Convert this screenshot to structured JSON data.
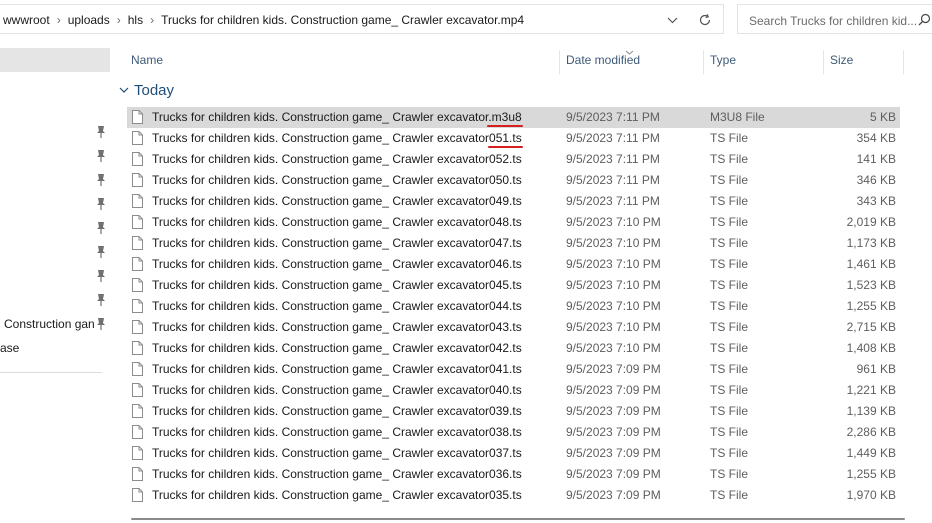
{
  "address": {
    "crumbs": [
      "wwwroot",
      "uploads",
      "hls",
      "Trucks for children kids. Construction game_ Crawler excavator.mp4"
    ]
  },
  "search": {
    "placeholder": "Search Trucks for children kid..."
  },
  "nav": {
    "items": [
      {
        "label": "Construction gan"
      },
      {
        "label": "ase"
      }
    ]
  },
  "columns": {
    "name": "Name",
    "date": "Date modified",
    "type": "Type",
    "size": "Size"
  },
  "group": {
    "label": "Today"
  },
  "files": [
    {
      "name": "Trucks for children kids. Construction game_ Crawler excavator.m3u8",
      "date": "9/5/2023 7:11 PM",
      "type": "M3U8 File",
      "size": "5 KB",
      "selected": true
    },
    {
      "name": "Trucks for children kids. Construction game_ Crawler excavator051.ts",
      "date": "9/5/2023 7:11 PM",
      "type": "TS File",
      "size": "354 KB"
    },
    {
      "name": "Trucks for children kids. Construction game_ Crawler excavator052.ts",
      "date": "9/5/2023 7:11 PM",
      "type": "TS File",
      "size": "141 KB"
    },
    {
      "name": "Trucks for children kids. Construction game_ Crawler excavator050.ts",
      "date": "9/5/2023 7:11 PM",
      "type": "TS File",
      "size": "346 KB"
    },
    {
      "name": "Trucks for children kids. Construction game_ Crawler excavator049.ts",
      "date": "9/5/2023 7:11 PM",
      "type": "TS File",
      "size": "343 KB"
    },
    {
      "name": "Trucks for children kids. Construction game_ Crawler excavator048.ts",
      "date": "9/5/2023 7:10 PM",
      "type": "TS File",
      "size": "2,019 KB"
    },
    {
      "name": "Trucks for children kids. Construction game_ Crawler excavator047.ts",
      "date": "9/5/2023 7:10 PM",
      "type": "TS File",
      "size": "1,173 KB"
    },
    {
      "name": "Trucks for children kids. Construction game_ Crawler excavator046.ts",
      "date": "9/5/2023 7:10 PM",
      "type": "TS File",
      "size": "1,461 KB"
    },
    {
      "name": "Trucks for children kids. Construction game_ Crawler excavator045.ts",
      "date": "9/5/2023 7:10 PM",
      "type": "TS File",
      "size": "1,523 KB"
    },
    {
      "name": "Trucks for children kids. Construction game_ Crawler excavator044.ts",
      "date": "9/5/2023 7:10 PM",
      "type": "TS File",
      "size": "1,255 KB"
    },
    {
      "name": "Trucks for children kids. Construction game_ Crawler excavator043.ts",
      "date": "9/5/2023 7:10 PM",
      "type": "TS File",
      "size": "2,715 KB"
    },
    {
      "name": "Trucks for children kids. Construction game_ Crawler excavator042.ts",
      "date": "9/5/2023 7:10 PM",
      "type": "TS File",
      "size": "1,408 KB"
    },
    {
      "name": "Trucks for children kids. Construction game_ Crawler excavator041.ts",
      "date": "9/5/2023 7:09 PM",
      "type": "TS File",
      "size": "961 KB"
    },
    {
      "name": "Trucks for children kids. Construction game_ Crawler excavator040.ts",
      "date": "9/5/2023 7:09 PM",
      "type": "TS File",
      "size": "1,221 KB"
    },
    {
      "name": "Trucks for children kids. Construction game_ Crawler excavator039.ts",
      "date": "9/5/2023 7:09 PM",
      "type": "TS File",
      "size": "1,139 KB"
    },
    {
      "name": "Trucks for children kids. Construction game_ Crawler excavator038.ts",
      "date": "9/5/2023 7:09 PM",
      "type": "TS File",
      "size": "2,286 KB"
    },
    {
      "name": "Trucks for children kids. Construction game_ Crawler excavator037.ts",
      "date": "9/5/2023 7:09 PM",
      "type": "TS File",
      "size": "1,449 KB"
    },
    {
      "name": "Trucks for children kids. Construction game_ Crawler excavator036.ts",
      "date": "9/5/2023 7:09 PM",
      "type": "TS File",
      "size": "1,255 KB"
    },
    {
      "name": "Trucks for children kids. Construction game_ Crawler excavator035.ts",
      "date": "9/5/2023 7:09 PM",
      "type": "TS File",
      "size": "1,970 KB"
    }
  ],
  "icons": {
    "address_dropdown": "chevron-down-icon",
    "refresh": "refresh-icon",
    "search": "search-icon",
    "pin": "pin-icon",
    "file": "file-icon",
    "group_toggle": "chevron-down-icon"
  },
  "colors": {
    "selected_row": "#d9d9d9",
    "nav_selected": "#e5e5e5",
    "annotation_underline": "#d42020",
    "group_label": "#1f4e79"
  }
}
